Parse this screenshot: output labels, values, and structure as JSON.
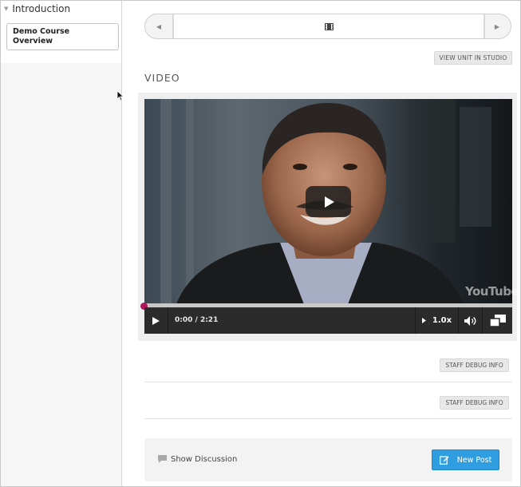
{
  "sidebar": {
    "chapter_title": "Introduction",
    "section_title_line1": "Demo Course",
    "section_title_line2": "Overview"
  },
  "sequence_nav": {
    "prev_icon": "triangle-left-icon",
    "tab_icon": "film-icon",
    "next_icon": "triangle-right-icon"
  },
  "actions": {
    "view_in_studio": "VIEW UNIT IN STUDIO"
  },
  "video_block": {
    "heading": "VIDEO",
    "watermark": "YouTube",
    "progress_fraction": 0.0,
    "time": "0:00 / 2:21",
    "speed": "1.0x",
    "accent_color": "#b0155c"
  },
  "debug": {
    "label_1": "STAFF DEBUG INFO",
    "label_2": "STAFF DEBUG INFO"
  },
  "discussion": {
    "show_label": "Show Discussion",
    "new_post_label": "New Post",
    "button_color": "#2f9ee0"
  }
}
